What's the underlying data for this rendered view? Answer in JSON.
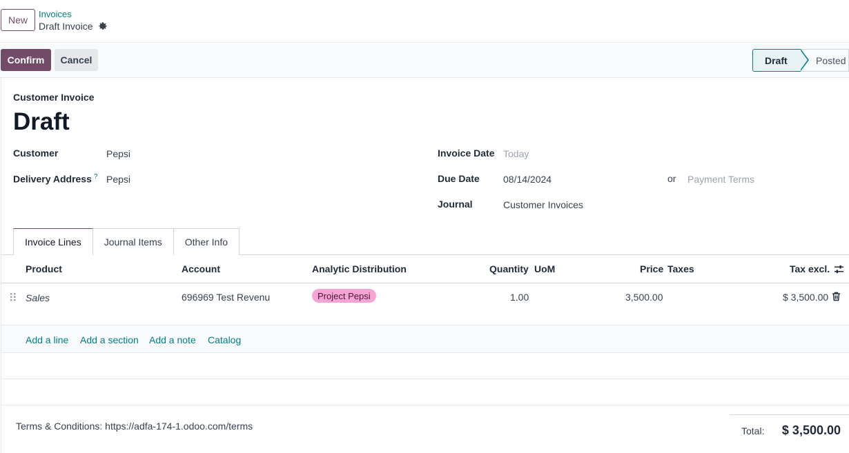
{
  "header": {
    "new_label": "New",
    "breadcrumb_parent": "Invoices",
    "breadcrumb_current": "Draft Invoice"
  },
  "actions": {
    "confirm_label": "Confirm",
    "cancel_label": "Cancel"
  },
  "statusbar": {
    "stages": [
      "Draft",
      "Posted"
    ],
    "current": "Draft"
  },
  "form": {
    "doc_type": "Customer Invoice",
    "title": "Draft",
    "customer_label": "Customer",
    "customer_value": "Pepsi",
    "delivery_label": "Delivery Address",
    "delivery_help": "?",
    "delivery_value": "Pepsi",
    "invoice_date_label": "Invoice Date",
    "invoice_date_placeholder": "Today",
    "due_date_label": "Due Date",
    "due_date_value": "08/14/2024",
    "or_label": "or",
    "payment_terms_placeholder": "Payment Terms",
    "journal_label": "Journal",
    "journal_value": "Customer Invoices"
  },
  "tabs": [
    {
      "label": "Invoice Lines",
      "active": true
    },
    {
      "label": "Journal Items",
      "active": false
    },
    {
      "label": "Other Info",
      "active": false
    }
  ],
  "table": {
    "headers": {
      "product": "Product",
      "account": "Account",
      "analytic": "Analytic Distribution",
      "quantity": "Quantity",
      "uom": "UoM",
      "price": "Price",
      "taxes": "Taxes",
      "tax_excl": "Tax excl."
    },
    "rows": [
      {
        "product": "Sales",
        "account": "696969 Test Revenu",
        "analytic": "Project Pepsi",
        "quantity": "1.00",
        "uom": "",
        "price": "3,500.00",
        "taxes": "",
        "tax_excl": "$ 3,500.00"
      }
    ],
    "add_links": [
      "Add a line",
      "Add a section",
      "Add a note",
      "Catalog"
    ]
  },
  "footer": {
    "terms": "Terms & Conditions: https://adfa-174-1.odoo.com/terms",
    "total_label": "Total:",
    "total_value": "$ 3,500.00"
  },
  "colors": {
    "primary": "#714b67",
    "link": "#017e84",
    "tag": "#f6a4d4"
  }
}
